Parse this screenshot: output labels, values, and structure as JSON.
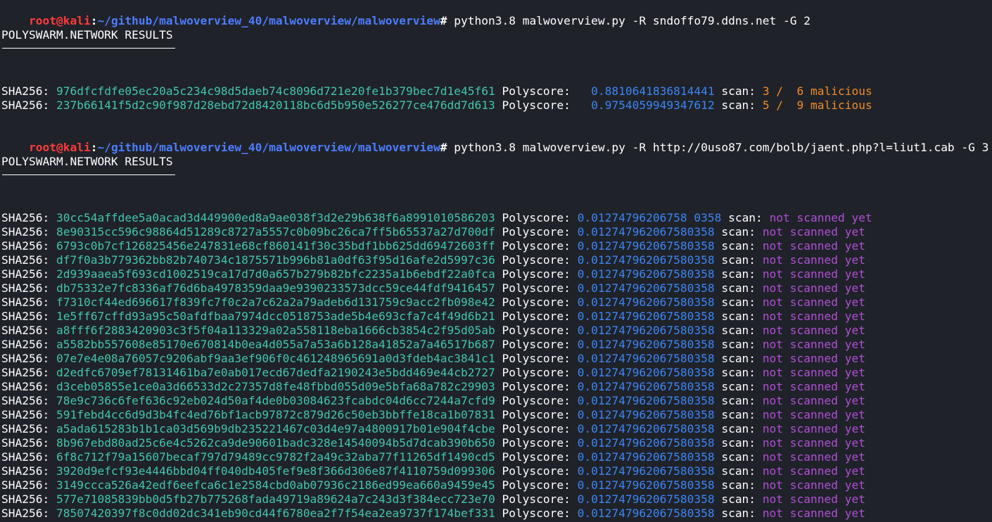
{
  "prompt": {
    "user": "root",
    "at": "@",
    "host": "kali",
    "colon": ":",
    "path": "~/github/malwoverview_40/malwoverview/malwoverview",
    "hash": "#"
  },
  "commands": [
    " python3.8 malwoverview.py -R sndoffo79.ddns.net -G 2",
    " python3.8 malwoverview.py -R http://0uso87.com/bolb/jaent.php?l=liut1.cab -G 3"
  ],
  "labels": {
    "section_title": "POLYSWARM.NETWORK RESULTS",
    "sha_label": "SHA256: ",
    "polyscore_label": " Polyscore: ",
    "scan_label": " scan: "
  },
  "results1": [
    {
      "hash": "976dfcfdfe05ec20a5c234c98d5daeb74c8096d721e20fe1b379bec7d1e45f61",
      "score": "  0.8810641836814441",
      "scan": "3 /  6 malicious"
    },
    {
      "hash": "237b66141f5d2c90f987d28ebd72d8420118bc6d5b950e526277ce476dd7d613",
      "score": "  0.9754059949347612",
      "scan": "5 /  9 malicious"
    }
  ],
  "results2": [
    {
      "hash": "30cc54affdee5a0acad3d449900ed8a9ae038f3d2e29b638f6a8991010586203",
      "score": "0.01274796206758 0358",
      "scan": "not scanned yet"
    },
    {
      "hash": "8e90315cc596c98864d51289c8727a5557c0b09bc26ca7ff5b65537a27d700df",
      "score": "0.012747962067580358",
      "scan": "not scanned yet"
    },
    {
      "hash": "6793c0b7cf126825456e247831e68cf860141f30c35bdf1bb625dd69472603ff",
      "score": "0.012747962067580358",
      "scan": "not scanned yet"
    },
    {
      "hash": "df7f0a3b779362bb82b740734c1875571b996b81a0df63f95d16afe2d5997c36",
      "score": "0.012747962067580358",
      "scan": "not scanned yet"
    },
    {
      "hash": "2d939aaea5f693cd1002519ca17d7d0a657b279b82bfc2235a1b6ebdf22a0fca",
      "score": "0.012747962067580358",
      "scan": "not scanned yet"
    },
    {
      "hash": "db75332e7fc8336af76d6ba4978359daa9e9390233573dcc59ce44fdf9416457",
      "score": "0.012747962067580358",
      "scan": "not scanned yet"
    },
    {
      "hash": "f7310cf44ed696617f839fc7f0c2a7c62a2a79adeb6d131759c9acc2fb098e42",
      "score": "0.012747962067580358",
      "scan": "not scanned yet"
    },
    {
      "hash": "1e5ff67cffd93a95c50afdfbaa7974dcc0518753ade5b4e693cfa7c4f49d6b21",
      "score": "0.012747962067580358",
      "scan": "not scanned yet"
    },
    {
      "hash": "a8fff6f2883420903c3f5f04a113329a02a558118eba1666cb3854c2f95d05ab",
      "score": "0.012747962067580358",
      "scan": "not scanned yet"
    },
    {
      "hash": "a5582bb557608e85170e670814b0ea4d055a7a53a6b128a41852a7a46517b687",
      "score": "0.012747962067580358",
      "scan": "not scanned yet"
    },
    {
      "hash": "07e7e4e08a76057c9206abf9aa3ef906f0c461248965691a0d3fdeb4ac3841c1",
      "score": "0.012747962067580358",
      "scan": "not scanned yet"
    },
    {
      "hash": "d2edfc6709ef78131461ba7e0ab017ecd67dedfa2190243e5bdd469e44cb2727",
      "score": "0.012747962067580358",
      "scan": "not scanned yet"
    },
    {
      "hash": "d3ceb05855e1ce0a3d66533d2c27357d8fe48fbbd055d09e5bfa68a782c29903",
      "score": "0.012747962067580358",
      "scan": "not scanned yet"
    },
    {
      "hash": "78e9c736c6fef636c92eb024d50af4de0b03084623fcabdc04d6cc7244a7cfd9",
      "score": "0.012747962067580358",
      "scan": "not scanned yet"
    },
    {
      "hash": "591febd4cc6d9d3b4fc4ed76bf1acb97872c879d26c50eb3bbffe18ca1b07831",
      "score": "0.012747962067580358",
      "scan": "not scanned yet"
    },
    {
      "hash": "a5ada615283b1b1ca03d569b9db235221467c03d4e97a4800917b01e904f4cbe",
      "score": "0.012747962067580358",
      "scan": "not scanned yet"
    },
    {
      "hash": "8b967ebd80ad25c6e4c5262ca9de90601badc328e14540094b5d7dcab390b650",
      "score": "0.012747962067580358",
      "scan": "not scanned yet"
    },
    {
      "hash": "6f8c712f79a15607becaf797d79489cc9782f2a49c32aba77f11265df1490cd5",
      "score": "0.012747962067580358",
      "scan": "not scanned yet"
    },
    {
      "hash": "3920d9efcf93e4446bbd04ff040db405fef9e8f366d306e87f4110759d099306",
      "score": "0.012747962067580358",
      "scan": "not scanned yet"
    },
    {
      "hash": "3149ccca526a42edf6eefca6c1e2584cbd0ab07936c2186ed99ea660a9459e45",
      "score": "0.012747962067580358",
      "scan": "not scanned yet"
    },
    {
      "hash": "577e71085839bb0d5fb27b775268fada49719a89624a7c243d3f384ecc723e70",
      "score": "0.012747962067580358",
      "scan": "not scanned yet"
    },
    {
      "hash": "78507420397f8c0dd02dc341eb90cd44f6780ea2f7f54ea2ea9737f174bef331",
      "score": "0.012747962067580358",
      "scan": "not scanned yet"
    }
  ],
  "colors": {
    "background": "#1f2229",
    "prompt_user": "#ff3b3b",
    "prompt_path": "#4d7dff",
    "hash": "#43c6ab",
    "score": "#3d86f4",
    "malicious": "#f28c28",
    "not_scanned": "#b24fd6"
  }
}
